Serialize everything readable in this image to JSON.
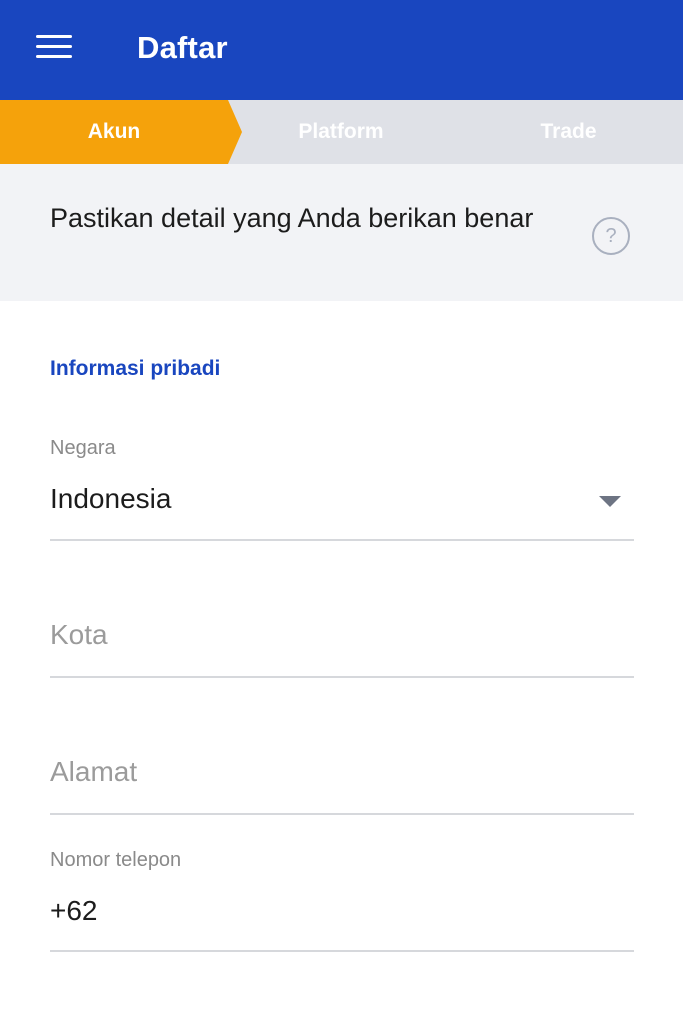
{
  "appbar": {
    "title": "Daftar",
    "menu_icon": "hamburger-menu-icon",
    "color": "#1946bf"
  },
  "stepper": {
    "steps": [
      {
        "label": "Akun",
        "active": true
      },
      {
        "label": "Platform",
        "active": false
      },
      {
        "label": "Trade",
        "active": false
      }
    ],
    "active_color": "#f5a20b",
    "inactive_color": "#dfe1e7"
  },
  "notice": {
    "text": "Pastikan detail yang Anda berikan benar",
    "help_icon": "help-question-icon",
    "help_glyph": "?"
  },
  "form": {
    "section_title": "Informasi pribadi",
    "country": {
      "label": "Negara",
      "value": "Indonesia",
      "icon": "dropdown-arrow-icon"
    },
    "city": {
      "placeholder": "Kota"
    },
    "address": {
      "placeholder": "Alamat"
    },
    "phone": {
      "label": "Nomor telepon",
      "value": "+62"
    }
  }
}
